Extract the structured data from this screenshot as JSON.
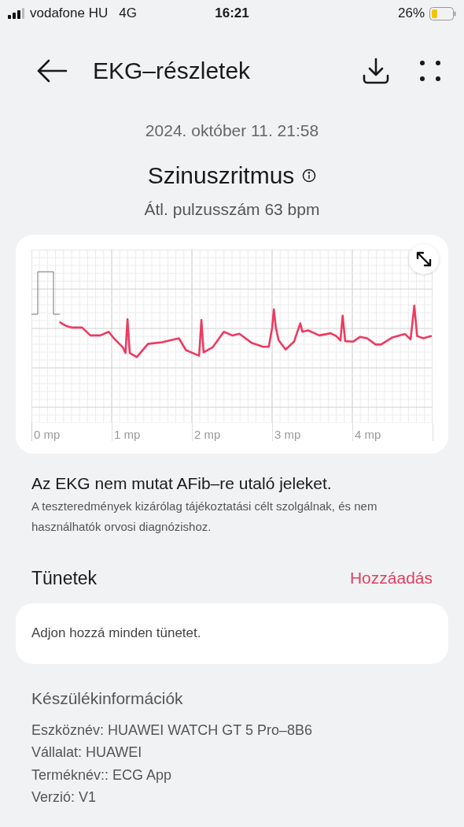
{
  "status_bar": {
    "carrier": "vodafone HU",
    "network": "4G",
    "time": "16:21",
    "battery": "26%"
  },
  "header": {
    "title": "EKG–részletek"
  },
  "date": "2024. október 11. 21:58",
  "result": {
    "title": "Szinuszritmus",
    "average": "Átl. pulzusszám 63 bpm"
  },
  "ecg": {
    "time_labels": [
      "0 mp",
      "1 mp",
      "2 mp",
      "3 mp",
      "4 mp"
    ]
  },
  "summary": {
    "headline": "Az EKG nem mutat AFib–re utaló jeleket.",
    "disclaimer": "A teszteredmények kizárólag tájékoztatási célt szolgálnak, és nem használhatók orvosi diagnózishoz."
  },
  "symptoms": {
    "title": "Tünetek",
    "action": "Hozzáadás",
    "placeholder": "Adjon hozzá minden tünetet."
  },
  "device_info": {
    "title": "Készülékinformációk",
    "lines": [
      "Eszköznév: HUAWEI WATCH GT 5 Pro–8B6",
      "Vállalat: HUAWEI",
      "Terméknév:: ECG App",
      "Verzió: V1"
    ]
  }
}
